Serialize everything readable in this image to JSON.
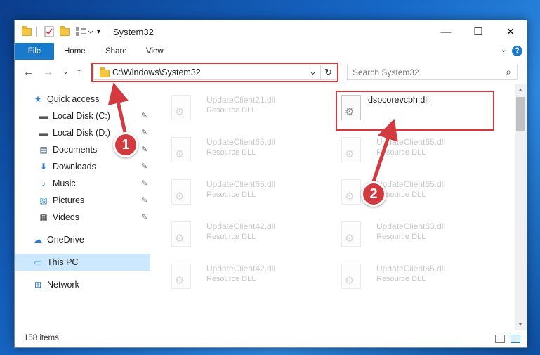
{
  "window": {
    "title": "System32",
    "minimize_glyph": "—",
    "maximize_glyph": "☐",
    "close_glyph": "✕"
  },
  "ribbon": {
    "tabs": [
      "File",
      "Home",
      "Share",
      "View"
    ],
    "help": "?"
  },
  "navigation": {
    "back": "←",
    "forward": "→",
    "recent": "⌄",
    "up": "↑",
    "address": "C:\\Windows\\System32",
    "address_dropdown": "⌄",
    "refresh": "↻",
    "search_placeholder": "Search System32",
    "search_icon": "⌕"
  },
  "sidebar": {
    "items": [
      {
        "label": "Quick access",
        "icon": "star-icon",
        "glyph": "★",
        "pinned": false
      },
      {
        "label": "Local Disk (C:)",
        "icon": "drive-icon",
        "glyph": "▬",
        "pinned": true
      },
      {
        "label": "Local Disk (D:)",
        "icon": "drive-icon",
        "glyph": "▬",
        "pinned": true
      },
      {
        "label": "Documents",
        "icon": "documents-icon",
        "glyph": "▤",
        "pinned": true
      },
      {
        "label": "Downloads",
        "icon": "download-icon",
        "glyph": "⬇",
        "pinned": true
      },
      {
        "label": "Music",
        "icon": "music-icon",
        "glyph": "♪",
        "pinned": true
      },
      {
        "label": "Pictures",
        "icon": "pictures-icon",
        "glyph": "▧",
        "pinned": true
      },
      {
        "label": "Videos",
        "icon": "videos-icon",
        "glyph": "▦",
        "pinned": true
      },
      {
        "label": "OneDrive",
        "icon": "cloud-icon",
        "glyph": "☁",
        "pinned": false
      },
      {
        "label": "This PC",
        "icon": "computer-icon",
        "glyph": "▭",
        "pinned": false
      },
      {
        "label": "Network",
        "icon": "network-icon",
        "glyph": "⊞",
        "pinned": false
      }
    ],
    "pin_glyph": "✎"
  },
  "files": [
    {
      "name": "UpdateClient21.dll",
      "type": "Resource DLL",
      "faded": true
    },
    {
      "name": "dspcorevcph.dll",
      "type": "",
      "faded": false
    },
    {
      "name": "UpdateClient65.dll",
      "type": "Resource DLL",
      "faded": true
    },
    {
      "name": "UpdateClient65.dll",
      "type": "Resource DLL",
      "faded": true
    },
    {
      "name": "UpdateClient65.dll",
      "type": "Resource DLL",
      "faded": true
    },
    {
      "name": "UpdateClient65.dll",
      "type": "Resource DLL",
      "faded": true
    },
    {
      "name": "UpdateClient42.dll",
      "type": "Resource DLL",
      "faded": true
    },
    {
      "name": "UpdateClient63.dll",
      "type": "Resource DLL",
      "faded": true
    },
    {
      "name": "UpdateClient42.dll",
      "type": "Resource DLL",
      "faded": true
    },
    {
      "name": "UpdateClient65.dll",
      "type": "Resource DLL",
      "faded": true
    }
  ],
  "status": {
    "item_count": "158 items"
  },
  "callouts": [
    "1",
    "2"
  ],
  "colors": {
    "accent": "#1979ca",
    "highlight": "#d9363e",
    "selection": "#cce8ff"
  }
}
